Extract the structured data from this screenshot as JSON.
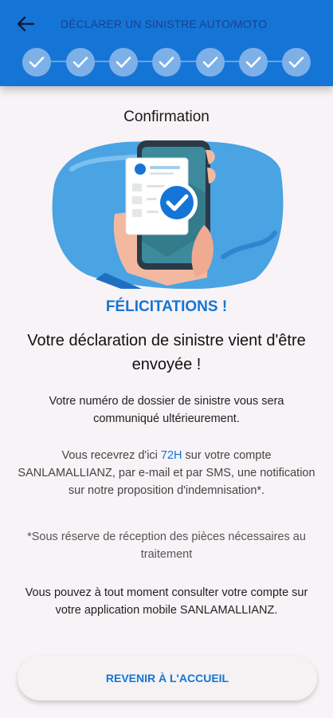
{
  "header": {
    "title": "DÉCLARER UN SINISTRE AUTO/MOTO",
    "back_icon": "arrow-left-icon",
    "steps": [
      {
        "status": "done",
        "icon": "check-icon"
      },
      {
        "status": "done",
        "icon": "check-icon"
      },
      {
        "status": "done",
        "icon": "check-icon"
      },
      {
        "status": "done",
        "icon": "check-icon"
      },
      {
        "status": "done",
        "icon": "check-icon"
      },
      {
        "status": "done",
        "icon": "check-icon"
      },
      {
        "status": "done",
        "icon": "check-icon"
      }
    ]
  },
  "main": {
    "section_title": "Confirmation",
    "congrats": "FÉLICITATIONS !",
    "subtitle": "Votre déclaration de sinistre vient d'être envoyée !",
    "paragraph1": "Votre numéro de dossier de sinistre vous sera communiqué ultérieurement.",
    "paragraph2_before": "Vous recevrez d'ici ",
    "paragraph2_highlight": "72H",
    "paragraph2_after": " sur votre compte SANLAMALLIANZ, par e-mail et par SMS, une notification sur notre proposition d'indemnisation*.",
    "paragraph3": "*Sous réserve de réception des pièces nécessaires au traitement",
    "paragraph4": "Vous pouvez à tout moment consulter votre compte sur votre application mobile SANLAMALLIANZ."
  },
  "footer": {
    "home_button_label": "REVENIR À L'ACCUEIL"
  },
  "colors": {
    "primary": "#1575d6",
    "step_circle": "#7eb0e8",
    "background": "#f8f3f6"
  }
}
